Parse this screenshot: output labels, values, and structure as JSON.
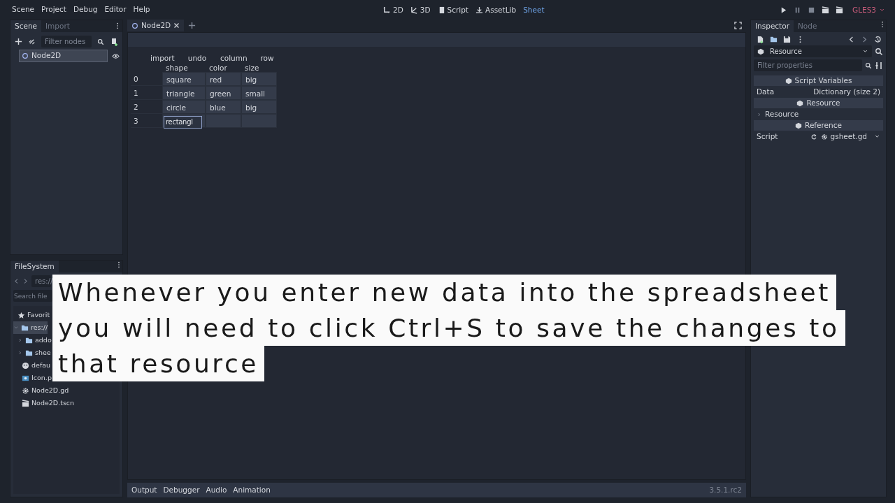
{
  "menu": [
    "Scene",
    "Project",
    "Debug",
    "Editor",
    "Help"
  ],
  "workspaces": [
    {
      "label": "2D",
      "kind": "canvas",
      "selected": false
    },
    {
      "label": "3D",
      "kind": "spatial",
      "selected": false
    },
    {
      "label": "Script",
      "kind": "script",
      "selected": false
    },
    {
      "label": "AssetLib",
      "kind": "assetlib",
      "selected": false
    },
    {
      "label": "Sheet",
      "kind": "plugin",
      "selected": true
    }
  ],
  "renderer": "GLES3",
  "scene_dock": {
    "tabs": [
      {
        "label": "Scene",
        "selected": true
      },
      {
        "label": "Import",
        "selected": false
      }
    ],
    "filter": {
      "placeholder": "Filter nodes"
    },
    "tree": [
      {
        "label": "Node2D",
        "selected": true
      }
    ]
  },
  "editor_tabs": [
    {
      "label": "Node2D",
      "selected": true
    }
  ],
  "sheet": {
    "actions": [
      "import",
      "undo",
      "column",
      "row"
    ],
    "columns": [
      "shape",
      "color",
      "size"
    ],
    "rows": [
      {
        "label": "0",
        "cells": [
          {
            "text": "square",
            "editing": false
          },
          {
            "text": "red",
            "editing": false
          },
          {
            "text": "big",
            "editing": false
          }
        ]
      },
      {
        "label": "1",
        "cells": [
          {
            "text": "triangle",
            "editing": false
          },
          {
            "text": "green",
            "editing": false
          },
          {
            "text": "small",
            "editing": false
          }
        ]
      },
      {
        "label": "2",
        "cells": [
          {
            "text": "circle",
            "editing": false
          },
          {
            "text": "blue",
            "editing": false
          },
          {
            "text": "big",
            "editing": false
          }
        ]
      },
      {
        "label": "3",
        "cells": [
          {
            "text": "rectangl",
            "editing": true
          }
        ]
      }
    ]
  },
  "filesystem": {
    "tabs": [
      {
        "label": "FileSystem",
        "selected": true
      }
    ],
    "path": "res://",
    "search": {
      "placeholder": "Search file"
    },
    "tree": [
      {
        "label": "Favorit",
        "kind": "favorites"
      },
      {
        "label": "res://",
        "kind": "folder",
        "selected": true,
        "expanded": true,
        "children": [
          {
            "label": "addo",
            "kind": "folder",
            "expanded": false
          },
          {
            "label": "shee",
            "kind": "folder",
            "expanded": false
          },
          {
            "label": "defau",
            "kind": "environment"
          },
          {
            "label": "Icon.p",
            "kind": "image"
          },
          {
            "label": "Node2D.gd",
            "kind": "script"
          },
          {
            "label": "Node2D.tscn",
            "kind": "scene"
          }
        ]
      }
    ]
  },
  "inspector": {
    "tabs": [
      {
        "label": "Inspector",
        "selected": true
      },
      {
        "label": "Node",
        "selected": false
      }
    ],
    "resource": "Resource",
    "filter": {
      "placeholder": "Filter properties"
    },
    "rows": [
      {
        "kind": "section",
        "label": "Script Variables"
      },
      {
        "kind": "property",
        "label": "Data",
        "value": "Dictionary (size 2)"
      },
      {
        "kind": "section",
        "label": "Resource"
      },
      {
        "kind": "group",
        "label": "Resource",
        "expanded": false
      },
      {
        "kind": "section",
        "label": "Reference"
      },
      {
        "kind": "script",
        "label": "Script",
        "value": "gsheet.gd"
      }
    ]
  },
  "bottom_panels": [
    "Output",
    "Debugger",
    "Audio",
    "Animation"
  ],
  "version": "3.5.1.rc2",
  "caption": [
    "Whenever you enter new data into the spreadsheet",
    "you will need to click Ctrl+S to save the changes to",
    "that resource"
  ]
}
